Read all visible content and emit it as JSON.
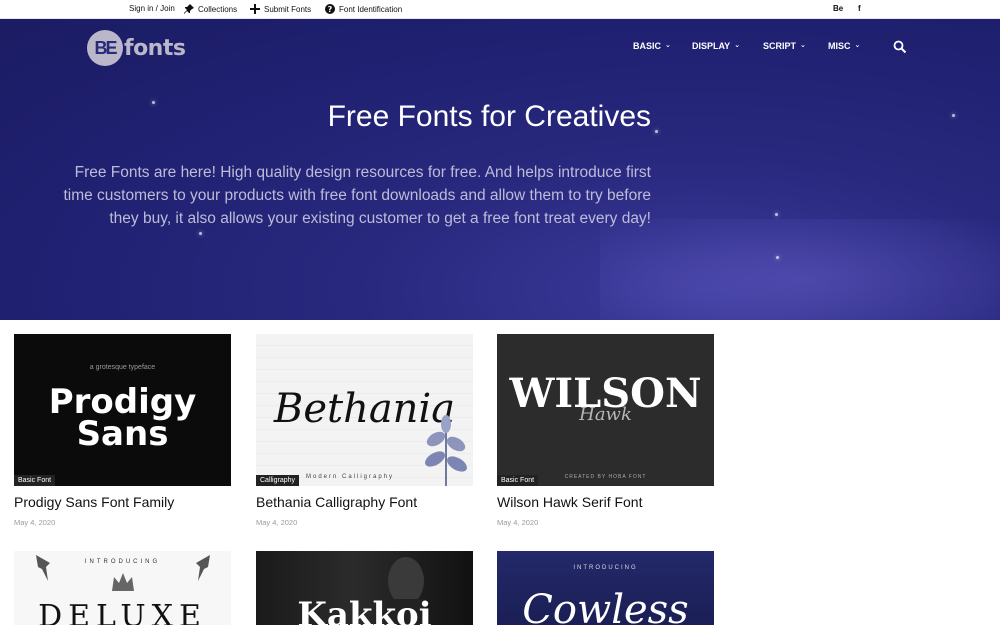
{
  "topbar": {
    "signin": "Sign in / Join",
    "collections": "Collections",
    "submit": "Submit Fonts",
    "identification": "Font Identification",
    "social_be": "Be",
    "social_fb": "f"
  },
  "header": {
    "logo_mark": "BE",
    "logo_word": "fonts",
    "nav": [
      {
        "label": "BASIC"
      },
      {
        "label": "DISPLAY"
      },
      {
        "label": "SCRIPT"
      },
      {
        "label": "MISC"
      }
    ]
  },
  "hero": {
    "title": "Free Fonts for Creatives",
    "text": "Free Fonts are here! High quality design resources for free. And helps introduce first time customers to your products with free font downloads and allow them to try before they buy, it also allows your existing customer to get a free font treat every day!"
  },
  "cards": [
    {
      "title": "Prodigy Sans Font Family",
      "date": "May 4, 2020",
      "tag": "Basic Font",
      "thumb_sub": "a grotesque typeface",
      "thumb_line1": "Prodigy",
      "thumb_line2": "Sans"
    },
    {
      "title": "Bethania Calligraphy Font",
      "date": "May 4, 2020",
      "tag": "Calligraphy",
      "thumb_word": "Bethania",
      "thumb_sub": "Modern Calligraphy"
    },
    {
      "title": "Wilson Hawk Serif Font",
      "date": "May 4, 2020",
      "tag": "Basic Font",
      "thumb_big": "WILSON",
      "thumb_sub": "Hawk",
      "thumb_foot": "CREATED BY HOBA FONT"
    },
    {
      "thumb_intro": "INTRODUCING",
      "thumb_big": "DELUXE"
    },
    {
      "thumb_big": "Kakkoi"
    },
    {
      "thumb_intro": "INTRODUCING",
      "thumb_big": "Cowless"
    }
  ],
  "colors": {
    "hero_bg": "#1f2070",
    "tag_bg": "#222222",
    "accent_logo": "#b9b7c9"
  }
}
